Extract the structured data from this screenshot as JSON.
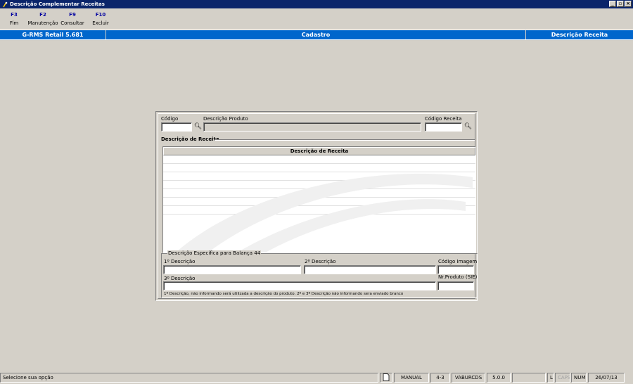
{
  "window": {
    "title": "Descrição Complementar Receitas",
    "buttons": [
      "_",
      "▫",
      "×"
    ]
  },
  "fkeys": [
    {
      "key": "F3",
      "label": "Fim"
    },
    {
      "key": "F2",
      "label": "Manutenção"
    },
    {
      "key": "F9",
      "label": "Consultar"
    },
    {
      "key": "F10",
      "label": "Excluir"
    }
  ],
  "header": {
    "system": "G-RMS Retail 5.681",
    "module": "Cadastro",
    "screen": "Descrição Receita"
  },
  "form": {
    "codigo_label": "Código",
    "codigo_value": "",
    "descricao_produto_label": "Descrição Produto",
    "descricao_produto_value": "",
    "codigo_receita_label": "Código Receita",
    "codigo_receita_value": "",
    "grid_group_title": "Descrição de Receita",
    "grid_column_header": "Descrição de Receita",
    "balanca_group_title": "Descrição Especifica para Balança 44",
    "desc1_label": "1º Descrição",
    "desc1_value": "",
    "desc2_label": "2º Descrição",
    "desc2_value": "",
    "codigo_imagem_label": "Código Imagem",
    "codigo_imagem_value": "",
    "desc3_label": "3º Descrição",
    "desc3_value": "",
    "nr_produto_label": "Nr.Produto (SIE)",
    "nr_produto_value": "",
    "footnote": "1º Descrição, não informando será utilizada a descrição do produto. 2º e 3º Descrição não informando sera enviado branco"
  },
  "status": {
    "message": "Selecione sua opção",
    "mode": "MANUAL",
    "code": "4-3",
    "user": "VABURCDS",
    "version": "5.0.0",
    "empty": "",
    "l": "L",
    "caps": "CAPS",
    "num": "NUM",
    "date": "26/07/13"
  },
  "colors": {
    "titlebar": "#0a246a",
    "header": "#0066cc",
    "background": "#d4d0c8",
    "fkey_text": "#0000a0"
  }
}
